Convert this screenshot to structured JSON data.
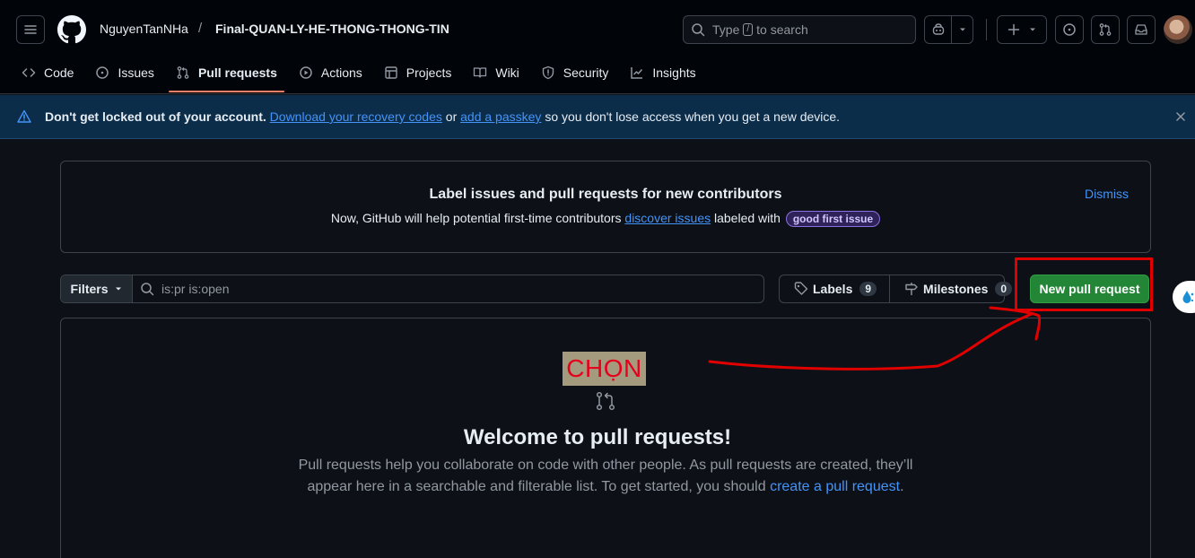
{
  "header": {
    "owner": "NguyenTanNHa",
    "separator": "/",
    "repo": "Final-QUAN-LY-HE-THONG-THONG-TIN",
    "search": {
      "prefix": "Type",
      "key": "/",
      "suffix": "to search"
    },
    "icons": [
      "hamburger-icon",
      "github-logo-icon",
      "copilot-icon",
      "plus-icon",
      "issues-icon",
      "pull-requests-icon",
      "inbox-icon"
    ]
  },
  "tabs": [
    {
      "label": "Code",
      "icon": "code-icon"
    },
    {
      "label": "Issues",
      "icon": "issue-opened-icon"
    },
    {
      "label": "Pull requests",
      "icon": "git-pull-request-icon",
      "active": true
    },
    {
      "label": "Actions",
      "icon": "play-icon"
    },
    {
      "label": "Projects",
      "icon": "table-icon"
    },
    {
      "label": "Wiki",
      "icon": "book-icon"
    },
    {
      "label": "Security",
      "icon": "shield-icon"
    },
    {
      "label": "Insights",
      "icon": "graph-icon"
    }
  ],
  "flash": {
    "bold": "Don't get locked out of your account.",
    "link1": "Download your recovery codes",
    "mid": "or",
    "link2": "add a passkey",
    "rest": "so you don't lose access when you get a new device."
  },
  "contributors": {
    "title": "Label issues and pull requests for new contributors",
    "desc_before": "Now, GitHub will help potential first-time contributors",
    "link": "discover issues",
    "desc_after": "labeled with",
    "label": "good first issue",
    "dismiss": "Dismiss"
  },
  "filters": {
    "button": "Filters",
    "query": "is:pr is:open",
    "labels": "Labels",
    "labels_count": "9",
    "milestones": "Milestones",
    "milestones_count": "0",
    "new_pr": "New pull request"
  },
  "annotation": {
    "text": "CHỌN",
    "color": "#e10000"
  },
  "blankslate": {
    "title": "Welcome to pull requests!",
    "desc": "Pull requests help you collaborate on code with other people. As pull requests are created, they’ll appear here in a searchable and filterable list. To get started, you should",
    "link": "create a pull request",
    "end": "."
  },
  "colors": {
    "accent": "#238636",
    "link": "#4493f8",
    "tab_underline": "#f78166"
  }
}
